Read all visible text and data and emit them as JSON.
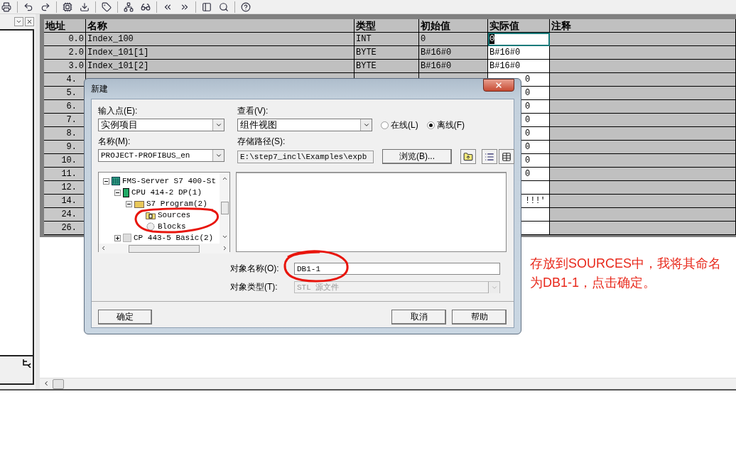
{
  "table": {
    "columns": [
      "地址",
      "名称",
      "类型",
      "初始值",
      "实际值",
      "注释"
    ],
    "rows": [
      {
        "kind": "full",
        "address": "0.0",
        "name": "Index_100",
        "type": "INT",
        "initial": "0",
        "actual": "0",
        "selected": true
      },
      {
        "kind": "full",
        "address": "2.0",
        "name": "Index_101[1]",
        "type": "BYTE",
        "initial": "B#16#0",
        "actual": "B#16#0",
        "selected": false
      },
      {
        "kind": "full",
        "address": "3.0",
        "name": "Index_101[2]",
        "type": "BYTE",
        "initial": "B#16#0",
        "actual": "B#16#0",
        "selected": false
      },
      {
        "kind": "covered",
        "address": "4.",
        "actual": "0",
        "selected": false
      },
      {
        "kind": "covered",
        "address": "5.",
        "actual": "0",
        "selected": false
      },
      {
        "kind": "covered",
        "address": "6.",
        "actual": "0",
        "selected": false
      },
      {
        "kind": "covered",
        "address": "7.",
        "actual": "0",
        "selected": false
      },
      {
        "kind": "covered",
        "address": "8.",
        "actual": "0",
        "selected": false
      },
      {
        "kind": "covered",
        "address": "9.",
        "actual": "0",
        "selected": false
      },
      {
        "kind": "covered",
        "address": "10.",
        "actual": "0",
        "selected": false
      },
      {
        "kind": "covered",
        "address": "11.",
        "actual": "0",
        "selected": false
      },
      {
        "kind": "covered",
        "address": "12.",
        "selected": false
      },
      {
        "kind": "covered",
        "address": "14.",
        "actual": "!!!'",
        "selected": false
      },
      {
        "kind": "covered",
        "address": "24.",
        "selected": false
      },
      {
        "kind": "covered",
        "address": "26.",
        "selected": false
      }
    ]
  },
  "dialog": {
    "title": "新建",
    "entry_point": {
      "label": "输入点(E):",
      "value": "实例项目"
    },
    "view": {
      "label": "查看(V):",
      "value": "组件视图"
    },
    "online_options": [
      {
        "label": "在线(L)",
        "selected": false
      },
      {
        "label": "离线(F)",
        "selected": true
      }
    ],
    "name": {
      "label": "名称(M):",
      "value": "PROJECT-PROFIBUS_en"
    },
    "storage_path": {
      "label": "存储路径(S):",
      "value": "E:\\step7_incl\\Examples\\expb"
    },
    "browse_button": "浏览(B)...",
    "tree": [
      {
        "label": "FMS-Server S7 400-St",
        "kind": "station",
        "expanded": true,
        "children": [
          {
            "label": "CPU 414-2 DP(1)",
            "kind": "cpu",
            "expanded": true,
            "children": [
              {
                "label": "S7 Program(2)",
                "kind": "program",
                "expanded": true,
                "children": [
                  {
                    "label": "Sources",
                    "kind": "folder"
                  },
                  {
                    "label": "Blocks",
                    "kind": "blocks"
                  }
                ]
              }
            ]
          },
          {
            "label": "CP 443-5 Basic(2)",
            "kind": "cp",
            "expanded": false
          }
        ]
      }
    ],
    "object_name": {
      "label": "对象名称(O):",
      "value": "DB1-1"
    },
    "object_type": {
      "label": "对象类型(T):",
      "value": "STL 源文件",
      "disabled": true
    },
    "buttons": [
      "确定",
      "取消",
      "帮助"
    ]
  },
  "annotation": {
    "text": "存放到SOURCES中，我将其命名为DB1-1，点击确定。"
  }
}
